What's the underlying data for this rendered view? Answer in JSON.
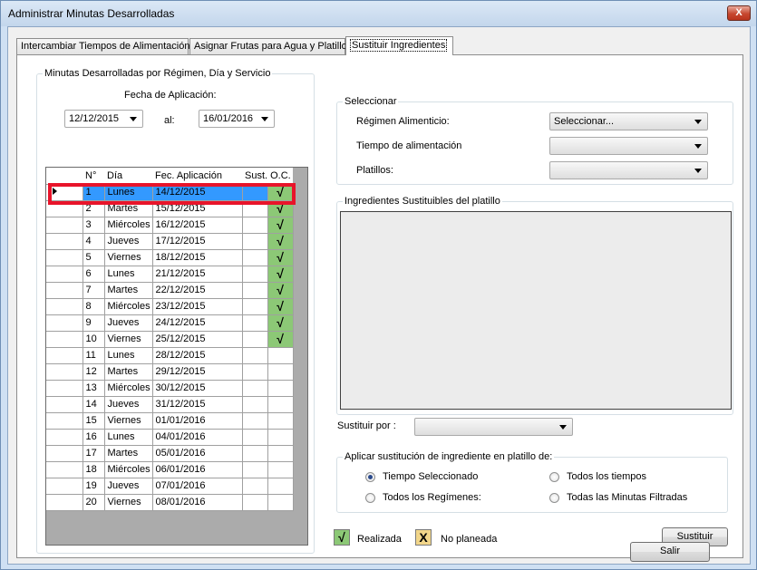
{
  "window": {
    "title": "Administrar Minutas Desarrolladas",
    "close_glyph": "X"
  },
  "tabs": [
    {
      "label": "Intercambiar Tiempos de Alimentación"
    },
    {
      "label": "Asignar Frutas para Agua y Platillo"
    },
    {
      "label": "Sustituir Ingredientes"
    }
  ],
  "left_group": {
    "legend": "Minutas Desarrolladas por Régimen, Día y Servicio",
    "fecha_label": "Fecha de Aplicación:",
    "from_date": "12/12/2015",
    "al_label": "al:",
    "to_date": "16/01/2016"
  },
  "grid": {
    "columns": [
      "N°",
      "Día",
      "Fec. Aplicación",
      "Sust.",
      "O.C."
    ],
    "check_glyph": "√",
    "selected_index": 0,
    "rows": [
      {
        "n": "1",
        "dia": "Lunes",
        "fecha": "14/12/2015",
        "sust": "",
        "oc": "√"
      },
      {
        "n": "2",
        "dia": "Martes",
        "fecha": "15/12/2015",
        "sust": "",
        "oc": "√"
      },
      {
        "n": "3",
        "dia": "Miércoles",
        "fecha": "16/12/2015",
        "sust": "",
        "oc": "√"
      },
      {
        "n": "4",
        "dia": "Jueves",
        "fecha": "17/12/2015",
        "sust": "",
        "oc": "√"
      },
      {
        "n": "5",
        "dia": "Viernes",
        "fecha": "18/12/2015",
        "sust": "",
        "oc": "√"
      },
      {
        "n": "6",
        "dia": "Lunes",
        "fecha": "21/12/2015",
        "sust": "",
        "oc": "√"
      },
      {
        "n": "7",
        "dia": "Martes",
        "fecha": "22/12/2015",
        "sust": "",
        "oc": "√"
      },
      {
        "n": "8",
        "dia": "Miércoles",
        "fecha": "23/12/2015",
        "sust": "",
        "oc": "√"
      },
      {
        "n": "9",
        "dia": "Jueves",
        "fecha": "24/12/2015",
        "sust": "",
        "oc": "√"
      },
      {
        "n": "10",
        "dia": "Viernes",
        "fecha": "25/12/2015",
        "sust": "",
        "oc": "√"
      },
      {
        "n": "11",
        "dia": "Lunes",
        "fecha": "28/12/2015",
        "sust": "",
        "oc": ""
      },
      {
        "n": "12",
        "dia": "Martes",
        "fecha": "29/12/2015",
        "sust": "",
        "oc": ""
      },
      {
        "n": "13",
        "dia": "Miércoles",
        "fecha": "30/12/2015",
        "sust": "",
        "oc": ""
      },
      {
        "n": "14",
        "dia": "Jueves",
        "fecha": "31/12/2015",
        "sust": "",
        "oc": ""
      },
      {
        "n": "15",
        "dia": "Viernes",
        "fecha": "01/01/2016",
        "sust": "",
        "oc": ""
      },
      {
        "n": "16",
        "dia": "Lunes",
        "fecha": "04/01/2016",
        "sust": "",
        "oc": ""
      },
      {
        "n": "17",
        "dia": "Martes",
        "fecha": "05/01/2016",
        "sust": "",
        "oc": ""
      },
      {
        "n": "18",
        "dia": "Miércoles",
        "fecha": "06/01/2016",
        "sust": "",
        "oc": ""
      },
      {
        "n": "19",
        "dia": "Jueves",
        "fecha": "07/01/2016",
        "sust": "",
        "oc": ""
      },
      {
        "n": "20",
        "dia": "Viernes",
        "fecha": "08/01/2016",
        "sust": "",
        "oc": ""
      }
    ]
  },
  "seleccionar": {
    "legend": "Seleccionar",
    "regimen_label": "Régimen Alimenticio:",
    "regimen_value": "Seleccionar...",
    "tiempo_label": "Tiempo de alimentación",
    "tiempo_value": "",
    "platillos_label": "Platillos:",
    "platillos_value": ""
  },
  "ingredientes": {
    "legend": "Ingredientes Sustituibles del platillo"
  },
  "sustituir_por": {
    "label": "Sustituir por :",
    "value": ""
  },
  "aplicar": {
    "legend": "Aplicar sustitución de ingrediente en platillo de:",
    "options": [
      {
        "label": "Tiempo Seleccionado",
        "checked": true
      },
      {
        "label": "Todos los tiempos",
        "checked": false
      },
      {
        "label": "Todos los Regímenes:",
        "checked": false
      },
      {
        "label": "Todas las Minutas Filtradas",
        "checked": false
      }
    ]
  },
  "legend_keys": {
    "realizada_glyph": "√",
    "realizada_label": "Realizada",
    "realizada_color": "#8cc876",
    "no_planeada_glyph": "X",
    "no_planeada_label": "No planeada",
    "no_planeada_color": "#f2d68a"
  },
  "buttons": {
    "sustituir": "Sustituir",
    "salir": "Salir"
  }
}
